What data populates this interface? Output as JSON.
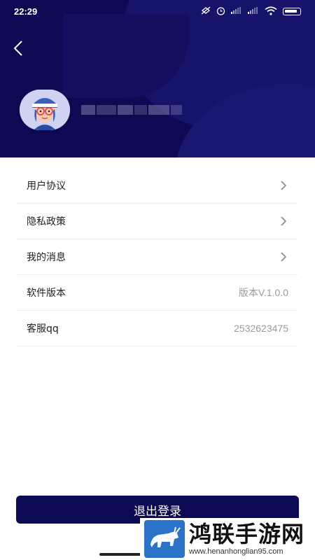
{
  "status_bar": {
    "time": "22:29",
    "icons": [
      "alarm-off-icon",
      "alarm-icon",
      "signal-icon",
      "signal-icon",
      "wifi-icon",
      "battery-icon"
    ]
  },
  "header": {
    "background_color": "#0c0a52",
    "back_icon": "chevron-left-icon",
    "avatar_icon": "user-avatar-icon"
  },
  "menu": {
    "items": [
      {
        "label": "用户协议",
        "value": "",
        "chevron": true
      },
      {
        "label": "隐私政策",
        "value": "",
        "chevron": true
      },
      {
        "label": "我的消息",
        "value": "",
        "chevron": true
      },
      {
        "label": "软件版本",
        "value": "版本V.1.0.0",
        "chevron": false
      },
      {
        "label": "客服qq",
        "value": "2532623475",
        "chevron": false
      }
    ]
  },
  "logout": {
    "label": "退出登录",
    "color": "#0c0a52"
  },
  "watermark": {
    "title": "鸿联手游网",
    "url": "www.henanhonglian95.com"
  }
}
